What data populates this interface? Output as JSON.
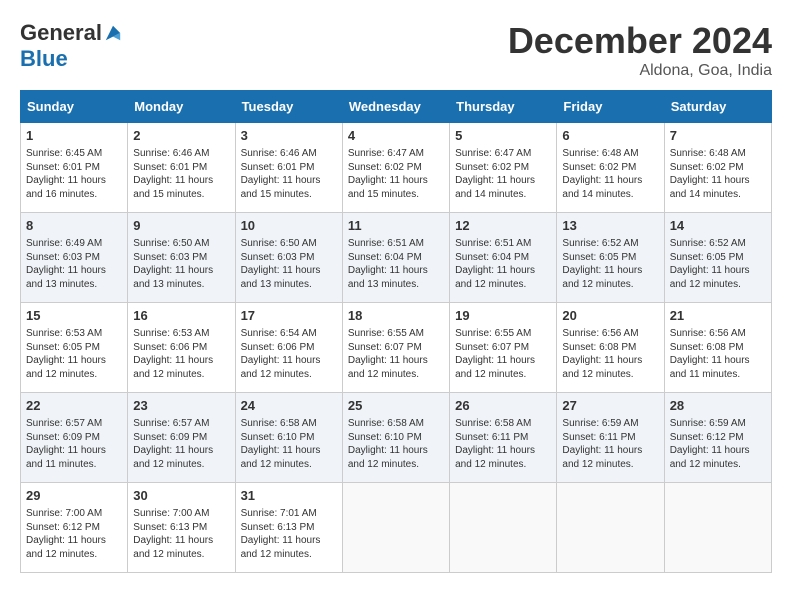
{
  "app": {
    "name_general": "General",
    "name_blue": "Blue"
  },
  "title": "December 2024",
  "subtitle": "Aldona, Goa, India",
  "days_of_week": [
    "Sunday",
    "Monday",
    "Tuesday",
    "Wednesday",
    "Thursday",
    "Friday",
    "Saturday"
  ],
  "weeks": [
    [
      {
        "day": "1",
        "sunrise": "6:45 AM",
        "sunset": "6:01 PM",
        "daylight": "11 hours and 16 minutes."
      },
      {
        "day": "2",
        "sunrise": "6:46 AM",
        "sunset": "6:01 PM",
        "daylight": "11 hours and 15 minutes."
      },
      {
        "day": "3",
        "sunrise": "6:46 AM",
        "sunset": "6:01 PM",
        "daylight": "11 hours and 15 minutes."
      },
      {
        "day": "4",
        "sunrise": "6:47 AM",
        "sunset": "6:02 PM",
        "daylight": "11 hours and 15 minutes."
      },
      {
        "day": "5",
        "sunrise": "6:47 AM",
        "sunset": "6:02 PM",
        "daylight": "11 hours and 14 minutes."
      },
      {
        "day": "6",
        "sunrise": "6:48 AM",
        "sunset": "6:02 PM",
        "daylight": "11 hours and 14 minutes."
      },
      {
        "day": "7",
        "sunrise": "6:48 AM",
        "sunset": "6:02 PM",
        "daylight": "11 hours and 14 minutes."
      }
    ],
    [
      {
        "day": "8",
        "sunrise": "6:49 AM",
        "sunset": "6:03 PM",
        "daylight": "11 hours and 13 minutes."
      },
      {
        "day": "9",
        "sunrise": "6:50 AM",
        "sunset": "6:03 PM",
        "daylight": "11 hours and 13 minutes."
      },
      {
        "day": "10",
        "sunrise": "6:50 AM",
        "sunset": "6:03 PM",
        "daylight": "11 hours and 13 minutes."
      },
      {
        "day": "11",
        "sunrise": "6:51 AM",
        "sunset": "6:04 PM",
        "daylight": "11 hours and 13 minutes."
      },
      {
        "day": "12",
        "sunrise": "6:51 AM",
        "sunset": "6:04 PM",
        "daylight": "11 hours and 12 minutes."
      },
      {
        "day": "13",
        "sunrise": "6:52 AM",
        "sunset": "6:05 PM",
        "daylight": "11 hours and 12 minutes."
      },
      {
        "day": "14",
        "sunrise": "6:52 AM",
        "sunset": "6:05 PM",
        "daylight": "11 hours and 12 minutes."
      }
    ],
    [
      {
        "day": "15",
        "sunrise": "6:53 AM",
        "sunset": "6:05 PM",
        "daylight": "11 hours and 12 minutes."
      },
      {
        "day": "16",
        "sunrise": "6:53 AM",
        "sunset": "6:06 PM",
        "daylight": "11 hours and 12 minutes."
      },
      {
        "day": "17",
        "sunrise": "6:54 AM",
        "sunset": "6:06 PM",
        "daylight": "11 hours and 12 minutes."
      },
      {
        "day": "18",
        "sunrise": "6:55 AM",
        "sunset": "6:07 PM",
        "daylight": "11 hours and 12 minutes."
      },
      {
        "day": "19",
        "sunrise": "6:55 AM",
        "sunset": "6:07 PM",
        "daylight": "11 hours and 12 minutes."
      },
      {
        "day": "20",
        "sunrise": "6:56 AM",
        "sunset": "6:08 PM",
        "daylight": "11 hours and 12 minutes."
      },
      {
        "day": "21",
        "sunrise": "6:56 AM",
        "sunset": "6:08 PM",
        "daylight": "11 hours and 11 minutes."
      }
    ],
    [
      {
        "day": "22",
        "sunrise": "6:57 AM",
        "sunset": "6:09 PM",
        "daylight": "11 hours and 11 minutes."
      },
      {
        "day": "23",
        "sunrise": "6:57 AM",
        "sunset": "6:09 PM",
        "daylight": "11 hours and 12 minutes."
      },
      {
        "day": "24",
        "sunrise": "6:58 AM",
        "sunset": "6:10 PM",
        "daylight": "11 hours and 12 minutes."
      },
      {
        "day": "25",
        "sunrise": "6:58 AM",
        "sunset": "6:10 PM",
        "daylight": "11 hours and 12 minutes."
      },
      {
        "day": "26",
        "sunrise": "6:58 AM",
        "sunset": "6:11 PM",
        "daylight": "11 hours and 12 minutes."
      },
      {
        "day": "27",
        "sunrise": "6:59 AM",
        "sunset": "6:11 PM",
        "daylight": "11 hours and 12 minutes."
      },
      {
        "day": "28",
        "sunrise": "6:59 AM",
        "sunset": "6:12 PM",
        "daylight": "11 hours and 12 minutes."
      }
    ],
    [
      {
        "day": "29",
        "sunrise": "7:00 AM",
        "sunset": "6:12 PM",
        "daylight": "11 hours and 12 minutes."
      },
      {
        "day": "30",
        "sunrise": "7:00 AM",
        "sunset": "6:13 PM",
        "daylight": "11 hours and 12 minutes."
      },
      {
        "day": "31",
        "sunrise": "7:01 AM",
        "sunset": "6:13 PM",
        "daylight": "11 hours and 12 minutes."
      },
      null,
      null,
      null,
      null
    ]
  ],
  "labels": {
    "sunrise": "Sunrise:",
    "sunset": "Sunset:",
    "daylight": "Daylight: 11 hours"
  }
}
